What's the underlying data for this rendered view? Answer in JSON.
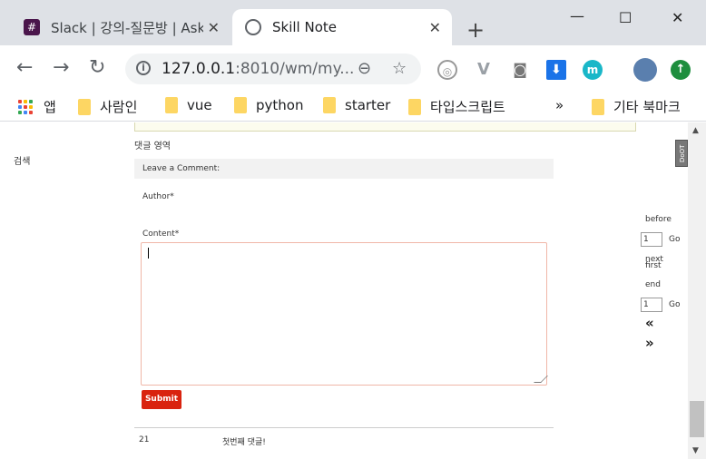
{
  "tabs": [
    {
      "title": "Slack | 강의-질문방 | Ask",
      "favicon_color": "#4a154b"
    },
    {
      "title": "Skill Note",
      "favicon_color": "#5f6368"
    }
  ],
  "window": {
    "minimize": "—",
    "maximize": "☐",
    "close": "✕"
  },
  "toolbar": {
    "url_host": "127.0.0.1",
    "url_rest": ":8010/wm/my...",
    "extension_m": "m"
  },
  "bookmarks": {
    "apps": "앱",
    "items": [
      "사람인",
      "vue",
      "python",
      "starter",
      "타입스크립트"
    ],
    "more": "»",
    "other": "기타 북마크"
  },
  "page": {
    "search_label": "검색",
    "section_label": "댓글 영역",
    "comment_header": "Leave a Comment:",
    "author_label": "Author*",
    "content_label": "Content*",
    "submit_label": "Submit",
    "comments": [
      {
        "id": "21",
        "text": "첫번째 댓글!"
      }
    ],
    "badge": "DoOT"
  },
  "pager": {
    "before": "before",
    "first": "first",
    "next": "next",
    "end": "end",
    "go": "Go",
    "page_value_1": "1",
    "page_value_2": "1",
    "prev_arrows": "«",
    "next_arrows": "»"
  },
  "colors": {
    "accent": "#d9230f",
    "textarea_border": "#f0b7a8"
  }
}
